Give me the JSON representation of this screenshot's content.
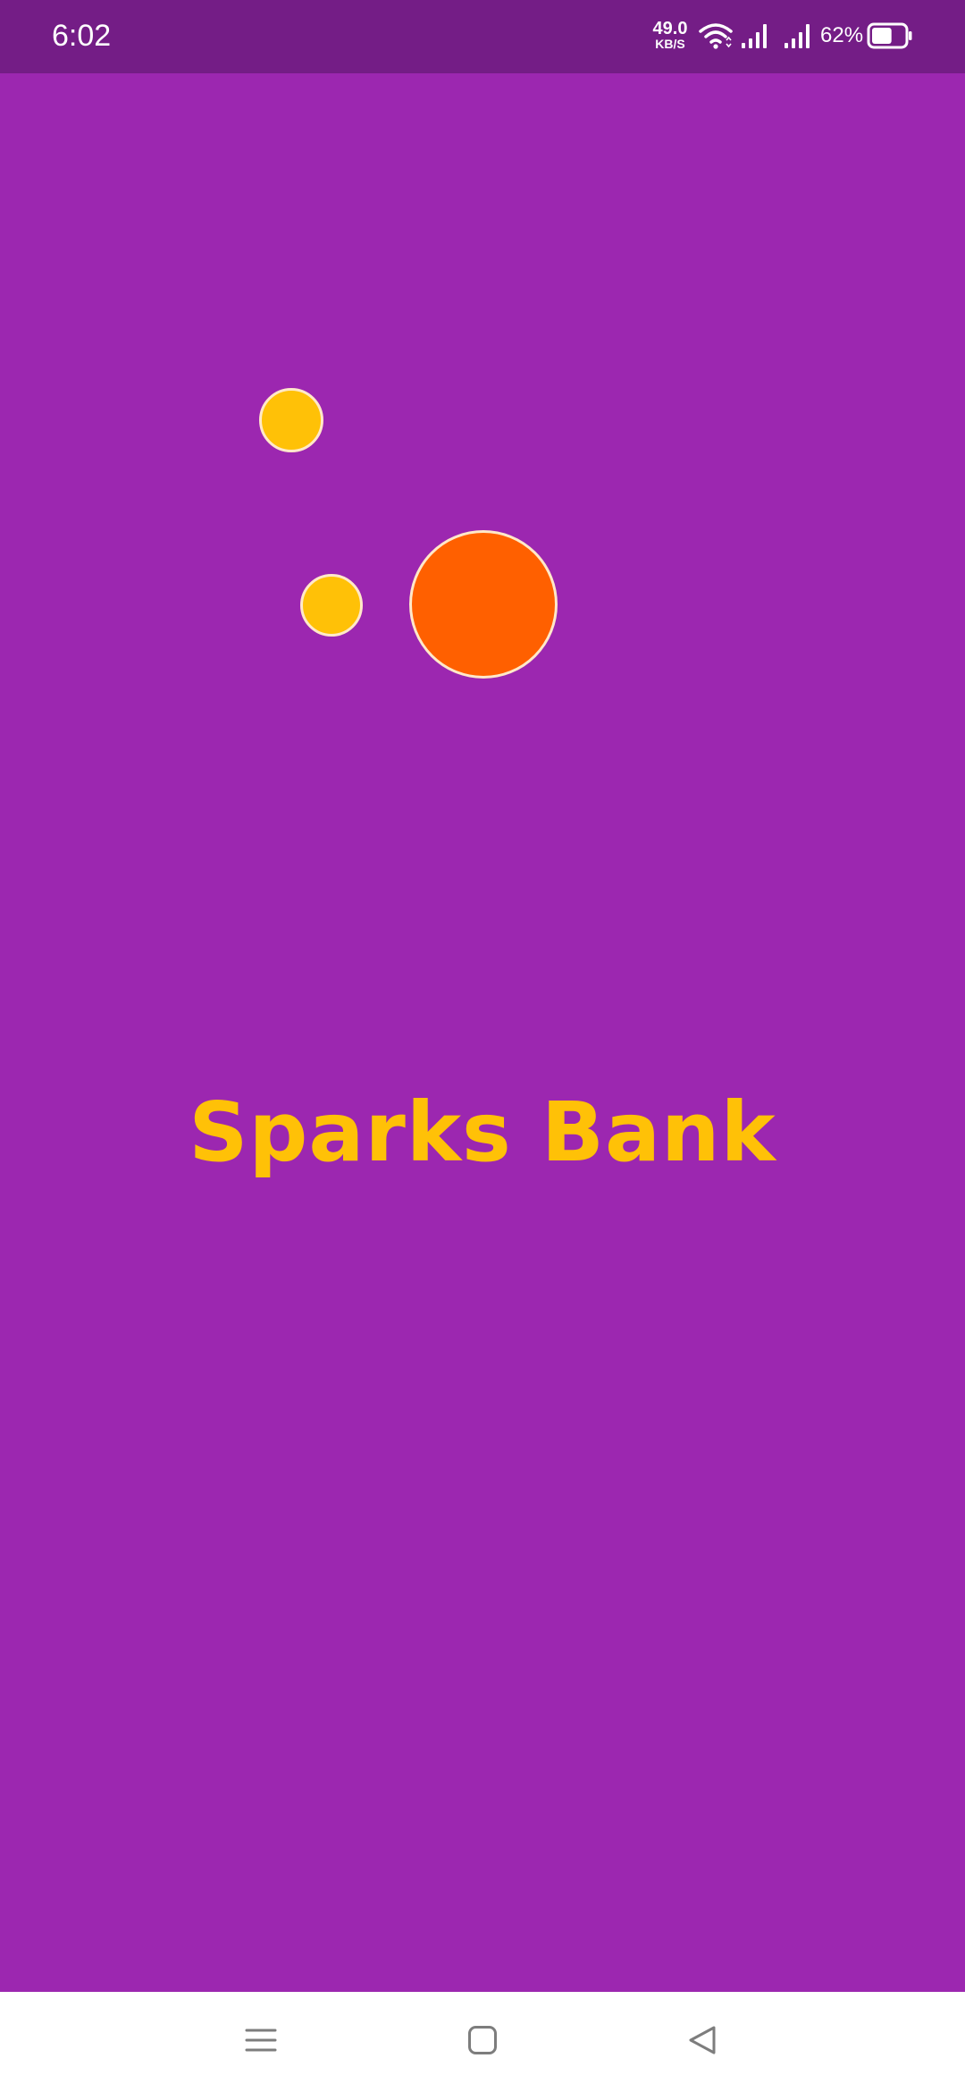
{
  "status_bar": {
    "time": "6:02",
    "net_speed_value": "49.0",
    "net_speed_unit": "KB/S",
    "battery_percent": "62%",
    "battery_level": 0.62,
    "icons": [
      "wifi-icon",
      "signal-icon",
      "signal-icon",
      "battery-icon"
    ]
  },
  "splash": {
    "title": "Sparks Bank",
    "background_color": "#9c27b0",
    "title_color": "#ffc107",
    "dot_colors": {
      "small_top": "#ffc107",
      "small_bottom": "#ffc107",
      "large": "#ff6000"
    }
  },
  "nav_bar": {
    "buttons": [
      "menu-icon",
      "home-icon",
      "back-icon"
    ]
  }
}
